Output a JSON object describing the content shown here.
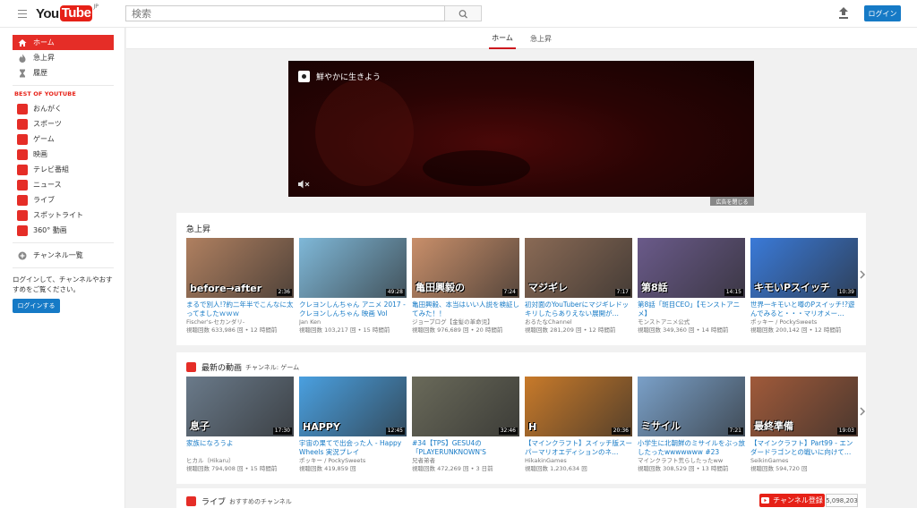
{
  "header": {
    "logo_you": "You",
    "logo_tube": "Tube",
    "logo_region": "JP",
    "search_placeholder": "検索",
    "login_label": "ログイン"
  },
  "sidebar": {
    "main_items": [
      {
        "label": "ホーム",
        "icon": "home-icon"
      },
      {
        "label": "急上昇",
        "icon": "flame-icon"
      },
      {
        "label": "履歴",
        "icon": "hourglass-icon"
      }
    ],
    "best_title": "BEST OF YOUTUBE",
    "categories": [
      {
        "label": "おんがく",
        "icon": "music-icon"
      },
      {
        "label": "スポーツ",
        "icon": "sports-icon"
      },
      {
        "label": "ゲーム",
        "icon": "game-icon"
      },
      {
        "label": "映画",
        "icon": "movie-icon"
      },
      {
        "label": "テレビ番組",
        "icon": "tv-icon"
      },
      {
        "label": "ニュース",
        "icon": "news-icon"
      },
      {
        "label": "ライブ",
        "icon": "live-icon"
      },
      {
        "label": "スポットライト",
        "icon": "spotlight-icon"
      },
      {
        "label": "360° 動画",
        "icon": "360-icon"
      }
    ],
    "channel_list": "チャンネル一覧",
    "login_prompt": "ログインして、チャンネルやおすすめをご覧ください。",
    "login_button": "ログインする"
  },
  "tabs": [
    {
      "label": "ホーム",
      "active": true
    },
    {
      "label": "急上昇",
      "active": false
    }
  ],
  "ad": {
    "title": "鮮やかに生きよう",
    "close_label": "広告を閉じる"
  },
  "trending": {
    "title": "急上昇",
    "videos": [
      {
        "title": "まるで別人!?約二年半でこんなに太ってましたｗｗｗ",
        "channel": "Fischer's-セカンダリ-",
        "views": "視聴回数 633,986 回",
        "age": "12 時間前",
        "duration": "2:36",
        "caption": "before→after",
        "bg": "#b08060"
      },
      {
        "title": "クレヨンしんちゃん アニメ 2017 - クレヨンしんちゃん 映画 Vol",
        "channel": "Jan Ken",
        "views": "視聴回数 103,217 回",
        "age": "15 時間前",
        "duration": "49:28",
        "caption": "",
        "bg": "#7fb8d8"
      },
      {
        "title": "亀田興毅、本当はいい人説を検証してみた！！",
        "channel": "ジョーブログ【金髪の革命児】",
        "views": "視聴回数 976,689 回",
        "age": "20 時間前",
        "duration": "7:24",
        "caption": "亀田興毅の",
        "bg": "#c98f6a"
      },
      {
        "title": "初対面のYouTuberにマジギレドッキリしたらありえない展開が…",
        "channel": "おるたなChannel",
        "views": "視聴回数 281,209 回",
        "age": "12 時間前",
        "duration": "7:17",
        "caption": "マジギレ",
        "bg": "#8a6a55"
      },
      {
        "title": "第8話「斑目CEO」【モンストアニメ】",
        "channel": "モンストアニメ公式",
        "views": "視聴回数 349,360 回",
        "age": "14 時間前",
        "duration": "14:15",
        "caption": "第8話",
        "bg": "#6a5a8a"
      },
      {
        "title": "世界一キモいと噂のPスイッチ!?遊んでみると・・・マリオメー…",
        "channel": "ポッキー / PockySweets",
        "views": "視聴回数 200,142 回",
        "age": "12 時間前",
        "duration": "10:39",
        "caption": "キモいPスイッチ",
        "bg": "#3a7ad8"
      }
    ]
  },
  "latest": {
    "title": "最新の動画",
    "channel_label": "チャンネル: ゲーム",
    "videos": [
      {
        "title": "家族になろうよ",
        "channel": "ヒカル（Hikaru）",
        "views": "視聴回数 794,908 回",
        "age": "15 時間前",
        "duration": "17:30",
        "caption": "息子",
        "bg": "#6a7a8a"
      },
      {
        "title": "宇宙の果てで出会った人 - Happy Wheels 実況プレイ",
        "channel": "ポッキー / PockySweets",
        "views": "視聴回数 419,859 回",
        "age": "",
        "duration": "12:45",
        "caption": "HAPPY",
        "bg": "#4aa0e0"
      },
      {
        "title": "#34【TPS】GESU4の「PLAYERUNKNOWN'S",
        "channel": "兄者弟者",
        "views": "視聴回数 472,269 回",
        "age": "3 日前",
        "duration": "32:46",
        "caption": "",
        "bg": "#6a6a5a"
      },
      {
        "title": "【マインクラフト】スイッチ版スーパーマリオエディションのネ…",
        "channel": "HikakinGames",
        "views": "視聴回数 1,230,634 回",
        "age": "",
        "duration": "20:36",
        "caption": "H",
        "bg": "#c87a2a"
      },
      {
        "title": "小学生に北朝鮮のミサイルをぶっ放したったwwwwwww #23",
        "channel": "マインクラフト荒らしたったww",
        "views": "視聴回数 308,529 回",
        "age": "13 時間前",
        "duration": "7:21",
        "caption": "ミサイル",
        "bg": "#7aa0c8"
      },
      {
        "title": "【マインクラフト】Part99 - エンダードラゴンとの戦いに向けて…",
        "channel": "SeikinGames",
        "views": "視聴回数 594,720 回",
        "age": "",
        "duration": "19:03",
        "caption": "最終準備",
        "bg": "#a05a3a"
      }
    ]
  },
  "live": {
    "title": "ライブ",
    "sub_label": "おすすめのチャンネル",
    "subscribe_label": "チャンネル登録",
    "subscriber_count": "5,098,203"
  },
  "colors": {
    "accent": "#e62117",
    "link": "#167ac6",
    "button": "#167ac6"
  }
}
